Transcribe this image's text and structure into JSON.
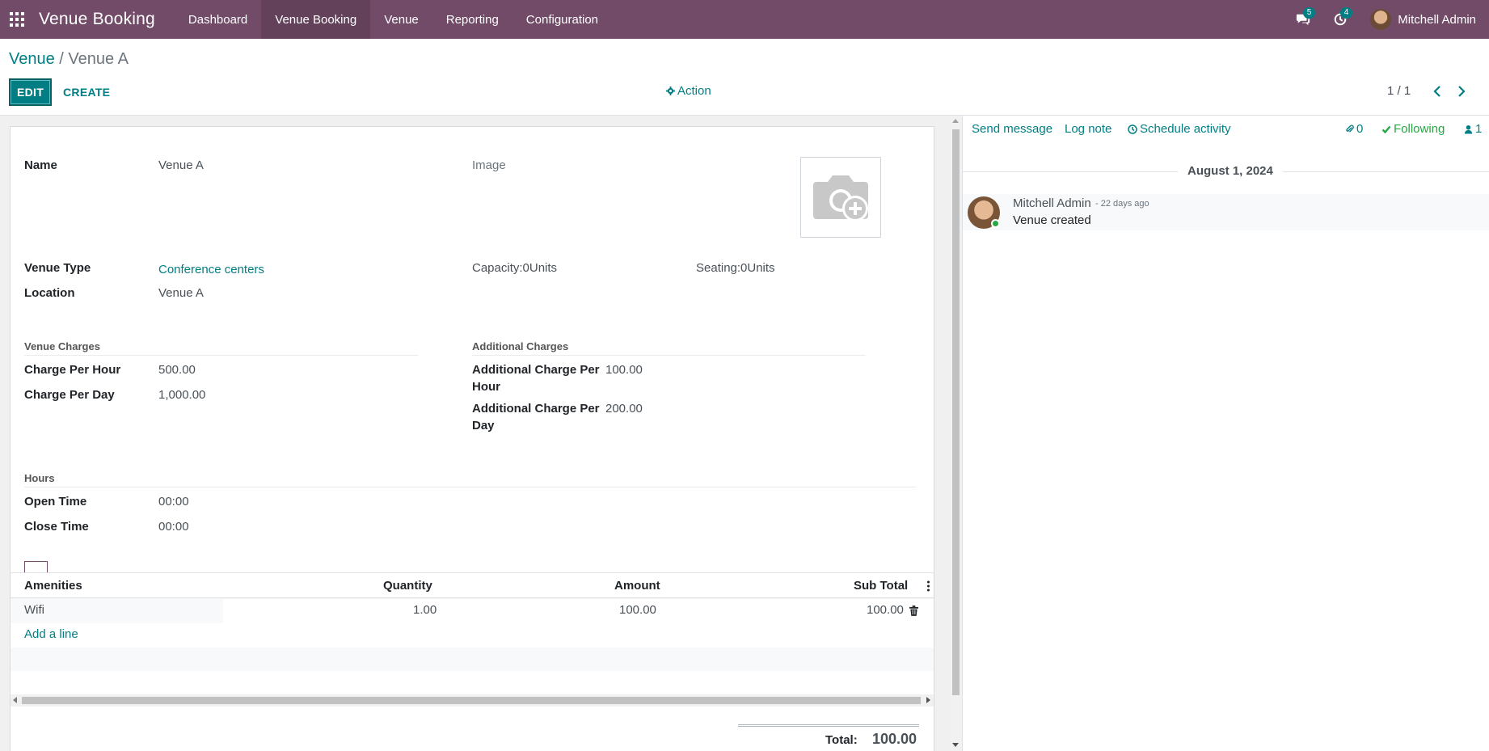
{
  "navbar": {
    "brand": "Venue Booking",
    "menu": [
      "Dashboard",
      "Venue Booking",
      "Venue",
      "Reporting",
      "Configuration"
    ],
    "active_menu": "Venue Booking",
    "messages_badge": "5",
    "activities_badge": "4",
    "user_name": "Mitchell Admin",
    "bg_color": "#714B67"
  },
  "breadcrumb": {
    "parent": "Venue",
    "separator": "/",
    "current": "Venue A"
  },
  "toolbar": {
    "edit_label": "EDIT",
    "create_label": "CREATE",
    "action_label": "Action",
    "pager": "1 / 1"
  },
  "form": {
    "name_label": "Name",
    "name_value": "Venue A",
    "image_label": "Image",
    "venue_type_label": "Venue Type",
    "venue_type_value": "Conference centers",
    "location_label": "Location",
    "location_value": "Venue A",
    "capacity": "Capacity:0Units",
    "seating": "Seating:0Units",
    "venue_charges_title": "Venue Charges",
    "charge_per_hour_label": "Charge Per Hour",
    "charge_per_hour_value": "500.00",
    "charge_per_day_label": "Charge Per Day",
    "charge_per_day_value": "1,000.00",
    "additional_charges_title": "Additional Charges",
    "add_charge_hour_label_1": "Additional Charge Per",
    "add_charge_hour_label_2": "Hour",
    "add_charge_hour_value": "100.00",
    "add_charge_day_label_1": "Additional Charge Per",
    "add_charge_day_label_2": "Day",
    "add_charge_day_value": "200.00",
    "hours_title": "Hours",
    "open_time_label": "Open Time",
    "open_time_value": "00:00",
    "close_time_label": "Close Time",
    "close_time_value": "00:00"
  },
  "amenities": {
    "columns": [
      "Amenities",
      "Quantity",
      "Amount",
      "Sub Total"
    ],
    "rows": [
      {
        "name": "Wifi",
        "quantity": "1.00",
        "amount": "100.00",
        "subtotal": "100.00"
      }
    ],
    "add_line": "Add a line",
    "total_label": "Total:",
    "total_value": "100.00"
  },
  "chatter": {
    "send_message": "Send message",
    "log_note": "Log note",
    "schedule_activity": "Schedule activity",
    "attachments_count": "0",
    "following": "Following",
    "followers_count": "1",
    "date": "August 1, 2024",
    "messages": [
      {
        "author": "Mitchell Admin",
        "time": "- 22 days ago",
        "body": "Venue created"
      }
    ]
  },
  "colors": {
    "primary": "#017e84",
    "brand": "#714B67",
    "following": "#28a745"
  }
}
